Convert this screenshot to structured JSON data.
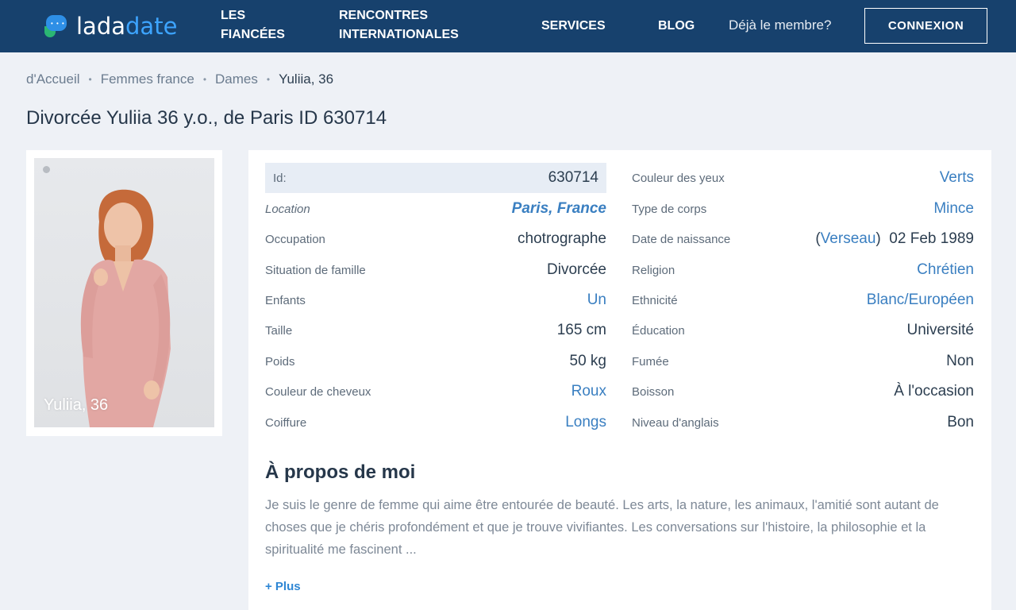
{
  "header": {
    "logo_part1": "lada",
    "logo_part2": "date",
    "nav": {
      "fiancees": "LES FIANCÉES",
      "international": "RENCONTRES INTERNATIONALES",
      "services": "SERVICES",
      "blog": "BLOG"
    },
    "member_text": "Déjà le membre?",
    "login_label": "CONNEXION"
  },
  "breadcrumb": [
    "d'Accueil",
    "Femmes france",
    "Dames",
    "Yuliia, 36"
  ],
  "page_title": "Divorcée Yuliia 36 y.o., de Paris ID 630714",
  "photo": {
    "caption": "Yuliia, 36"
  },
  "details_left": [
    {
      "label": "Id:",
      "value": "630714"
    },
    {
      "label": "Location",
      "value": "Paris, France"
    },
    {
      "label": "Occupation",
      "value": "chotrographe"
    },
    {
      "label": "Situation de famille",
      "value": "Divorcée"
    },
    {
      "label": "Enfants",
      "value": "Un"
    },
    {
      "label": "Taille",
      "value": "165 cm"
    },
    {
      "label": "Poids",
      "value": "50 kg"
    },
    {
      "label": "Couleur de cheveux",
      "value": "Roux"
    },
    {
      "label": "Coiffure",
      "value": "Longs"
    }
  ],
  "details_right": [
    {
      "label": "Couleur des yeux",
      "value": "Verts"
    },
    {
      "label": "Type de corps",
      "value": "Mince"
    },
    {
      "label": "Date de naissance",
      "zodiac": "Verseau",
      "value": "02 Feb 1989"
    },
    {
      "label": "Religion",
      "value": "Chrétien"
    },
    {
      "label": "Ethnicité",
      "value": "Blanc/Européen"
    },
    {
      "label": "Éducation",
      "value": "Université"
    },
    {
      "label": "Fumée",
      "value": "Non"
    },
    {
      "label": "Boisson",
      "value": "À l'occasion"
    },
    {
      "label": "Niveau d'anglais",
      "value": "Bon"
    }
  ],
  "about": {
    "title": "À propos de moi",
    "text": "Je suis le genre de femme qui aime être entourée de beauté. Les arts, la nature, les animaux, l'amitié sont autant de choses que je chéris profondément et que je trouve vivifiantes. Les conversations sur l'histoire, la philosophie et la spiritualité me fascinent ...",
    "more_label": "+ Plus"
  },
  "colors": {
    "header_bg": "#17416d",
    "link": "#3a7fc1",
    "accent": "#2e86d4"
  }
}
